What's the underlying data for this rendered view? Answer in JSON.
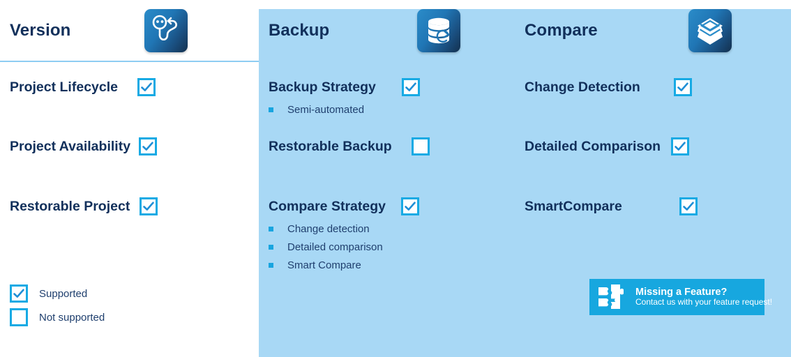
{
  "columns": [
    {
      "id": "version",
      "title": "Version",
      "icon": "version-tree-icon",
      "features": [
        {
          "label": "Project Lifecycle",
          "supported": true,
          "subitems": []
        },
        {
          "label": "Project Availability",
          "supported": true,
          "subitems": []
        },
        {
          "label": "Restorable Project",
          "supported": true,
          "subitems": []
        }
      ]
    },
    {
      "id": "backup",
      "title": "Backup",
      "icon": "database-restore-icon",
      "features": [
        {
          "label": "Backup Strategy",
          "supported": true,
          "subitems": [
            "Semi-automated"
          ]
        },
        {
          "label": "Restorable Backup",
          "supported": false,
          "subitems": []
        },
        {
          "label": "Compare Strategy",
          "supported": true,
          "subitems": [
            "Change detection",
            "Detailed comparison",
            "Smart Compare"
          ]
        }
      ]
    },
    {
      "id": "compare",
      "title": "Compare",
      "icon": "layers-icon",
      "features": [
        {
          "label": "Change Detection",
          "supported": true,
          "subitems": []
        },
        {
          "label": "Detailed Comparison",
          "supported": true,
          "subitems": []
        },
        {
          "label": "SmartCompare",
          "supported": true,
          "subitems": []
        }
      ]
    }
  ],
  "legend": {
    "supported_label": "Supported",
    "not_supported_label": "Not supported"
  },
  "banner": {
    "icon": "puzzle-piece-icon",
    "title": "Missing a Feature?",
    "subtitle": "Contact us with your feature request!",
    "background_color": "#17a7df"
  },
  "colors": {
    "heading_text": "#12305b",
    "body_text": "#1f3f6e",
    "accent_blue": "#17aae4",
    "rule_blue": "#8ecdf2",
    "bullet_blue": "#18a5e0"
  }
}
